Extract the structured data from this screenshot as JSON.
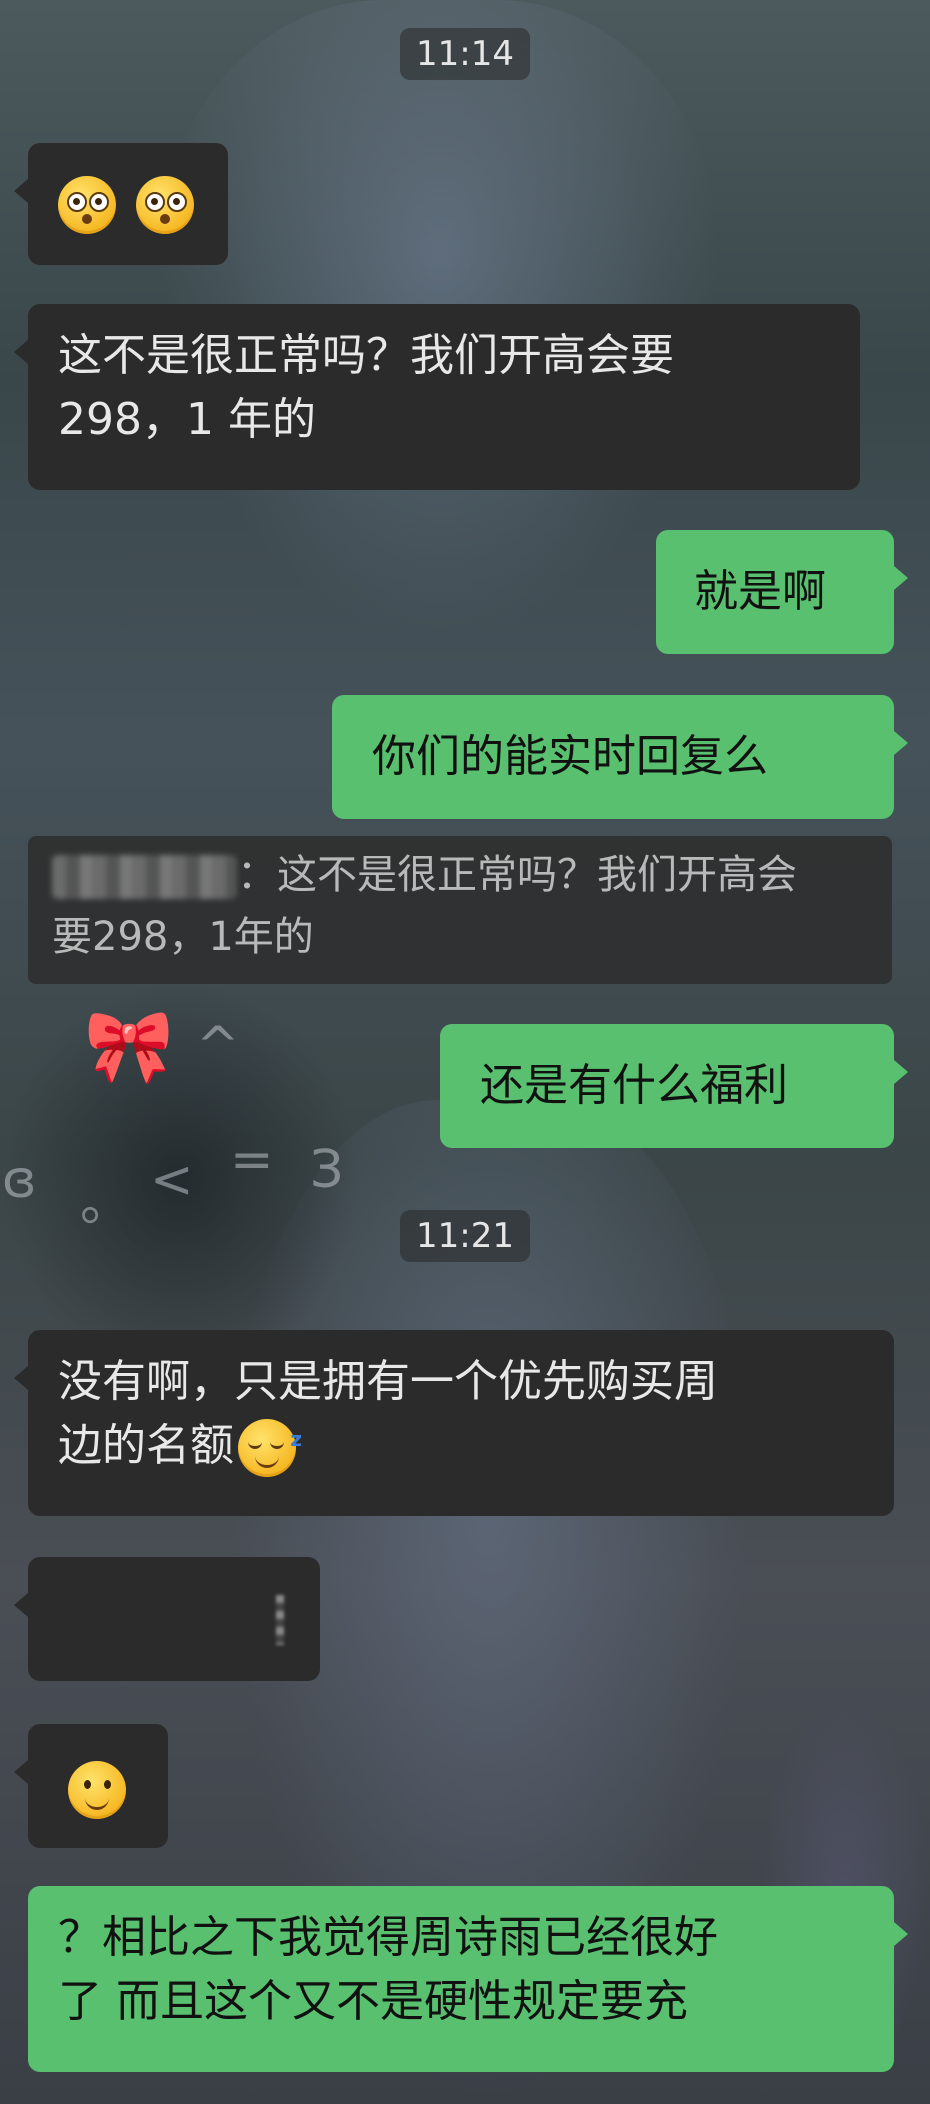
{
  "chat": {
    "times": [
      "11:14",
      "11:21"
    ],
    "messages": [
      {
        "side": "left",
        "emoji": [
          "flushed-face-icon",
          "flushed-face-icon"
        ]
      },
      {
        "side": "left",
        "text_line1": "这不是很正常吗？我们开高会要",
        "text_line2": "298，1 年的"
      },
      {
        "side": "right",
        "text": "就是啊"
      },
      {
        "side": "right",
        "text": "你们的能实时回复么"
      },
      {
        "side": "quote",
        "text_line1": "：这不是很正常吗？我们开高会",
        "text_line2": "要298，1年的"
      },
      {
        "side": "right",
        "text": "还是有什么福利"
      },
      {
        "side": "left",
        "text_line1": "没有啊，只是拥有一个优先购买周",
        "text_line2": "边的名额",
        "emoji": "sleeping-face-icon"
      },
      {
        "side": "left",
        "text": ""
      },
      {
        "side": "left",
        "emoji": "slightly-smiling-face-icon"
      },
      {
        "side": "right",
        "text_line1": "？相比之下我觉得周诗雨已经很好",
        "text_line2": "了  而且这个又不是硬性规定要充"
      }
    ]
  },
  "background": {
    "bow": "🎀",
    "doodles": [
      "^",
      "ɞ",
      "。",
      "<",
      "=",
      "З"
    ]
  },
  "colors": {
    "bubble_left": "#2b2b2b",
    "bubble_right": "#58c06f"
  }
}
